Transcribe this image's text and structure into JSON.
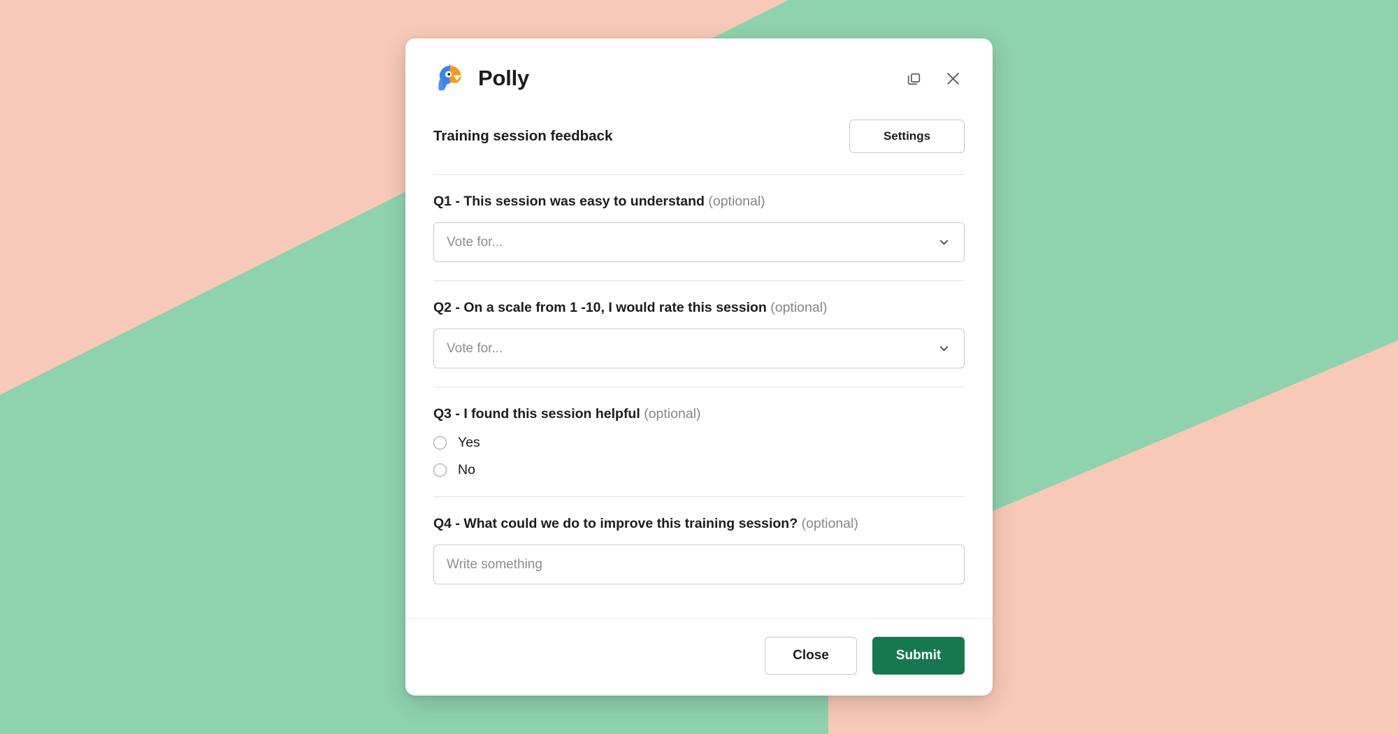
{
  "background": {
    "base_color": "#8fd2ae",
    "accent_color": "#f7c9b6"
  },
  "dialog": {
    "app_name": "Polly",
    "logo_icon": "polly-parrot-logo",
    "header_actions": [
      {
        "icon": "duplicate-icon",
        "label": "Duplicate"
      },
      {
        "icon": "close-icon",
        "label": "Close"
      }
    ],
    "poll_title": "Training session feedback",
    "settings_label": "Settings",
    "questions": [
      {
        "id": "q1",
        "label": "Q1 - This session was easy to understand",
        "optional_tag": "(optional)",
        "type": "select",
        "placeholder": "Vote for...",
        "value": "",
        "chevron_icon": "chevron-down-icon"
      },
      {
        "id": "q2",
        "label": "Q2 - On a scale from 1 -10, I would rate this session",
        "optional_tag": "(optional)",
        "type": "select",
        "placeholder": "Vote for...",
        "value": "",
        "chevron_icon": "chevron-down-icon"
      },
      {
        "id": "q3",
        "label": "Q3 - I found this session helpful",
        "optional_tag": "(optional)",
        "type": "radio",
        "options": [
          {
            "label": "Yes",
            "selected": false
          },
          {
            "label": "No",
            "selected": false
          }
        ]
      },
      {
        "id": "q4",
        "label": "Q4 - What could we do to improve this training session?",
        "optional_tag": "(optional)",
        "type": "text",
        "placeholder": "Write something",
        "value": ""
      }
    ],
    "footer": {
      "close_label": "Close",
      "submit_label": "Submit",
      "submit_color": "#17784f"
    }
  }
}
